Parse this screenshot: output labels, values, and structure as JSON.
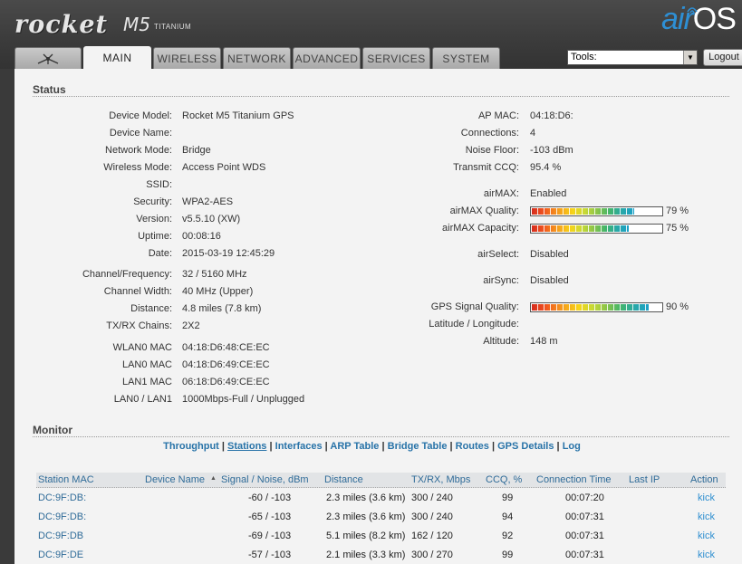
{
  "header": {
    "logo_rocket": "rocket",
    "logo_model": "M5",
    "logo_sub": "TITANIUM",
    "airos_air": "air",
    "airos_os": "OS"
  },
  "tabs": [
    {
      "label": "",
      "icon": "ubiquiti-antenna-icon"
    },
    {
      "label": "MAIN",
      "active": true
    },
    {
      "label": "WIRELESS"
    },
    {
      "label": "NETWORK"
    },
    {
      "label": "ADVANCED"
    },
    {
      "label": "SERVICES"
    },
    {
      "label": "SYSTEM"
    }
  ],
  "tools": {
    "selected": "Tools:"
  },
  "logout_label": "Logout",
  "status": {
    "title": "Status",
    "left": [
      {
        "label": "Device Model:",
        "value": "Rocket M5 Titanium GPS"
      },
      {
        "label": "Device Name:",
        "value": ""
      },
      {
        "label": "Network Mode:",
        "value": "Bridge"
      },
      {
        "label": "Wireless Mode:",
        "value": "Access Point WDS"
      },
      {
        "label": "SSID:",
        "value": ""
      },
      {
        "label": "Security:",
        "value": "WPA2-AES"
      },
      {
        "label": "Version:",
        "value": "v5.5.10 (XW)"
      },
      {
        "label": "Uptime:",
        "value": "00:08:16"
      },
      {
        "label": "Date:",
        "value": "2015-03-19 12:45:29"
      },
      {
        "label": "Channel/Frequency:",
        "value": "32 / 5160 MHz"
      },
      {
        "label": "Channel Width:",
        "value": "40 MHz (Upper)"
      },
      {
        "label": "Distance:",
        "value": "4.8 miles (7.8 km)"
      },
      {
        "label": "TX/RX Chains:",
        "value": "2X2"
      },
      {
        "label": "WLAN0 MAC",
        "value": "04:18:D6:48:CE:EC"
      },
      {
        "label": "LAN0 MAC",
        "value": "04:18:D6:49:CE:EC"
      },
      {
        "label": "LAN1 MAC",
        "value": "06:18:D6:49:CE:EC"
      },
      {
        "label": "LAN0 / LAN1",
        "value": "1000Mbps-Full / Unplugged"
      }
    ],
    "right": [
      {
        "label": "AP MAC:",
        "value": "04:18:D6:"
      },
      {
        "label": "Connections:",
        "value": "4"
      },
      {
        "label": "Noise Floor:",
        "value": "-103 dBm"
      },
      {
        "label": "Transmit CCQ:",
        "value": "95.4 %"
      },
      {
        "label": "airMAX:",
        "value": "Enabled"
      },
      {
        "label": "airMAX Quality:",
        "meter": 79,
        "value": "79 %"
      },
      {
        "label": "airMAX Capacity:",
        "meter": 75,
        "value": "75 %"
      },
      {
        "label": "airSelect:",
        "value": "Disabled"
      },
      {
        "label": "airSync:",
        "value": "Disabled"
      },
      {
        "label": "GPS Signal Quality:",
        "meter": 90,
        "value": "90 %"
      },
      {
        "label": "Latitude / Longitude:",
        "value": ""
      },
      {
        "label": "Altitude:",
        "value": "148 m"
      }
    ]
  },
  "monitor": {
    "title": "Monitor",
    "links": [
      {
        "label": "Throughput"
      },
      {
        "label": "Stations",
        "current": true
      },
      {
        "label": "Interfaces"
      },
      {
        "label": "ARP Table"
      },
      {
        "label": "Bridge Table"
      },
      {
        "label": "Routes"
      },
      {
        "label": "GPS Details"
      },
      {
        "label": "Log"
      }
    ],
    "separator": "|",
    "sort_indicator": "▲",
    "columns": [
      "Station MAC",
      "Device Name",
      "Signal / Noise, dBm",
      "Distance",
      "TX/RX, Mbps",
      "CCQ, %",
      "Connection Time",
      "Last IP",
      "Action"
    ],
    "rows": [
      [
        "DC:9F:DB:",
        "",
        "-60 / -103",
        "2.3 miles (3.6 km)",
        "300 / 240",
        "99",
        "00:07:20",
        "",
        "kick"
      ],
      [
        "DC:9F:DB:",
        "",
        "-65 / -103",
        "2.3 miles (3.6 km)",
        "300 / 240",
        "94",
        "00:07:31",
        "",
        "kick"
      ],
      [
        "DC:9F:DB",
        "",
        "-69 / -103",
        "5.1 miles (8.2 km)",
        "162 / 120",
        "92",
        "00:07:31",
        "",
        "kick"
      ],
      [
        "DC:9F:DE",
        "",
        "-57 / -103",
        "2.1 miles (3.3 km)",
        "300 / 270",
        "99",
        "00:07:31",
        "",
        "kick"
      ]
    ]
  }
}
